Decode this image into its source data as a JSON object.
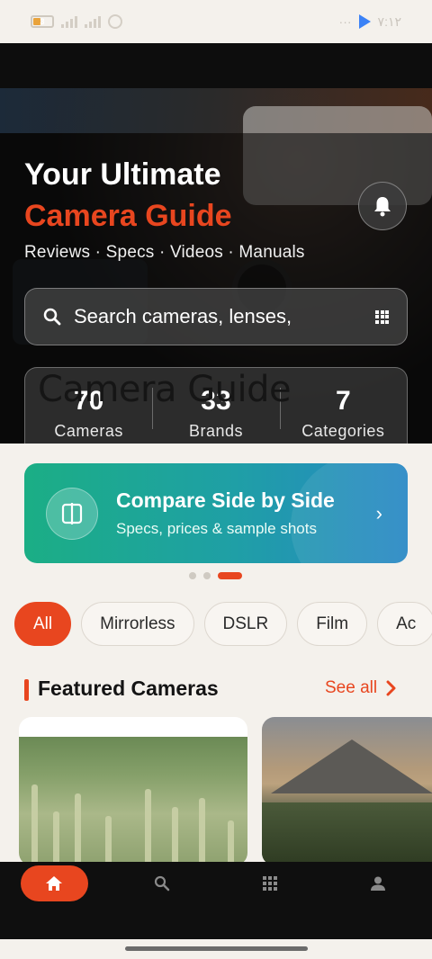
{
  "status_bar": {
    "battery": "3",
    "time": "٧:١٢",
    "dots": "···"
  },
  "hero": {
    "title_line1": "Your Ultimate",
    "title_line2": "Camera Guide",
    "subtitle": "Reviews · Specs · Videos · Manuals",
    "overlay_text": "Camera Guide"
  },
  "search": {
    "placeholder": "Search cameras, lenses,"
  },
  "stats": [
    {
      "value": "70",
      "label": "Cameras"
    },
    {
      "value": "33",
      "label": "Brands"
    },
    {
      "value": "7",
      "label": "Categories"
    }
  ],
  "compare": {
    "title": "Compare Side by Side",
    "subtitle": "Specs, prices & sample shots",
    "chevron": "›"
  },
  "carousel": {
    "page_count": 3,
    "active_index": 2
  },
  "chips": [
    {
      "label": "All",
      "active": true
    },
    {
      "label": "Mirrorless",
      "active": false
    },
    {
      "label": "DSLR",
      "active": false
    },
    {
      "label": "Film",
      "active": false
    },
    {
      "label": "Ac",
      "active": false
    }
  ],
  "featured": {
    "title": "Featured Cameras",
    "see_all": "See all"
  },
  "bottom_nav": [
    "home-icon",
    "search-icon",
    "grid-icon",
    "profile-icon"
  ],
  "colors": {
    "accent": "#e8461f",
    "compare_start": "#1bae85",
    "compare_end": "#2787c5",
    "background": "#f4f1ec"
  }
}
